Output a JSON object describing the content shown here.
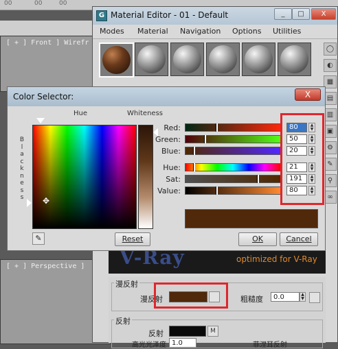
{
  "app": {
    "topbar_left": [
      "00",
      "00",
      "00"
    ],
    "viewport_top_label": "[ + ] Front ] Wirefr",
    "viewport_persp_label": "[ + ] Perspective ]"
  },
  "material_editor": {
    "title": "Material Editor - 01 - Default",
    "window_buttons": [
      "_",
      "□",
      "X"
    ],
    "menu": [
      "Modes",
      "Material",
      "Navigation",
      "Options",
      "Utilities"
    ],
    "vray_logo": "V-Ray",
    "vray_slogan": "optimized for V-Ray",
    "diffuse_group": "漫反射",
    "diffuse_label": "漫反射",
    "diffuse_color": "#50280a",
    "roughness_label": "粗糙度",
    "roughness_value": "0.0",
    "reflect_group": "反射",
    "reflect_label": "反射",
    "reflect_map_btn": "M",
    "highlight_label": "高光光泽度",
    "highlight_value": "1.0",
    "fresnel_label": "菲涅耳反射"
  },
  "color_selector": {
    "title": "Color Selector:",
    "close": "X",
    "hue_label": "Hue",
    "whiteness_label": "Whiteness",
    "blackness_label": "Blackness",
    "sliders": [
      {
        "label": "Red:",
        "value": "80",
        "selected": true
      },
      {
        "label": "Green:",
        "value": "50",
        "selected": false
      },
      {
        "label": "Blue:",
        "value": "20",
        "selected": false
      },
      {
        "label": "Hue:",
        "value": "21",
        "selected": false
      },
      {
        "label": "Sat:",
        "value": "191",
        "selected": false
      },
      {
        "label": "Value:",
        "value": "80",
        "selected": false
      }
    ],
    "current_color": "#50280a",
    "reset_label": "Reset",
    "ok_label": "OK",
    "cancel_label": "Cancel"
  },
  "highlight_color": "#e0262d"
}
